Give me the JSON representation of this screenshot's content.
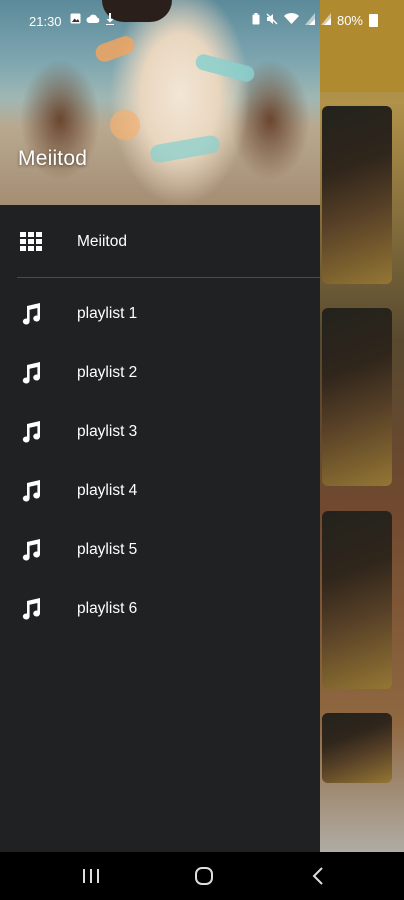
{
  "status_bar": {
    "time": "21:30",
    "battery": "80%",
    "left_icons": [
      "gallery-icon",
      "cloud-icon",
      "download-icon"
    ],
    "right_icons": [
      "battery-saver-icon",
      "mute-icon",
      "wifi-icon",
      "signal-icon",
      "signal-icon"
    ]
  },
  "drawer": {
    "header_title": "Meiitod",
    "items": [
      {
        "label": "Meiitod",
        "icon": "grid-icon"
      },
      {
        "label": "playlist 1",
        "icon": "music-note-icon"
      },
      {
        "label": "playlist 2",
        "icon": "music-note-icon"
      },
      {
        "label": "playlist 3",
        "icon": "music-note-icon"
      },
      {
        "label": "playlist 4",
        "icon": "music-note-icon"
      },
      {
        "label": "playlist 5",
        "icon": "music-note-icon"
      },
      {
        "label": "playlist 6",
        "icon": "music-note-icon"
      }
    ]
  },
  "nav_bar": {
    "buttons": [
      "recent-apps-icon",
      "home-icon",
      "back-icon"
    ]
  },
  "colors": {
    "drawer_bg": "#202122",
    "divider": "#4a4b4d",
    "text": "#ffffff",
    "navbar_bg": "#000000"
  }
}
